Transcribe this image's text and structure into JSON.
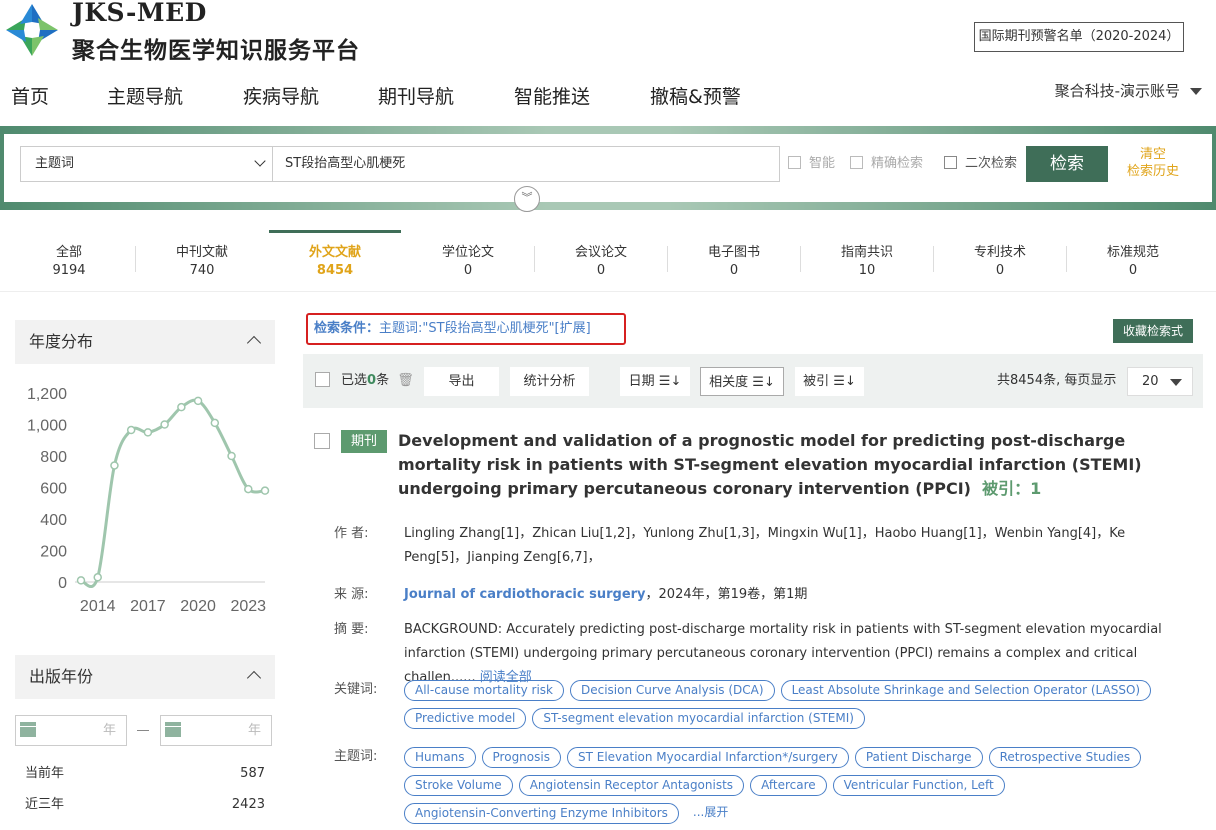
{
  "brand": {
    "en": "JKS-MED",
    "cn": "聚合生物医学知识服务平台"
  },
  "header": {
    "warning_list": "国际期刊预警名单（2020-2024）",
    "account": "聚合科技-演示账号"
  },
  "nav": [
    "首页",
    "主题导航",
    "疾病导航",
    "期刊导航",
    "智能推送",
    "撤稿&预警"
  ],
  "search": {
    "field": "主题词",
    "query": "ST段抬高型心肌梗死",
    "options": [
      "智能",
      "精确检索",
      "二次检索"
    ],
    "button": "检索",
    "clear_line1": "清空",
    "clear_line2": "检索历史"
  },
  "tabs": [
    {
      "label": "全部",
      "count": "9194"
    },
    {
      "label": "中刊文献",
      "count": "740"
    },
    {
      "label": "外文文献",
      "count": "8454"
    },
    {
      "label": "学位论文",
      "count": "0"
    },
    {
      "label": "会议论文",
      "count": "0"
    },
    {
      "label": "电子图书",
      "count": "0"
    },
    {
      "label": "指南共识",
      "count": "10"
    },
    {
      "label": "专利技术",
      "count": "0"
    },
    {
      "label": "标准规范",
      "count": "0"
    }
  ],
  "sidebar": {
    "year_dist_title": "年度分布",
    "pub_year_title": "出版年份",
    "year_unit": "年",
    "ranges": [
      {
        "label": "当前年",
        "count": "587"
      },
      {
        "label": "近三年",
        "count": "2423"
      }
    ]
  },
  "chart_data": {
    "type": "line",
    "x": [
      2013,
      2014,
      2015,
      2016,
      2017,
      2018,
      2019,
      2020,
      2021,
      2022,
      2023,
      2024
    ],
    "values": [
      10,
      30,
      740,
      965,
      950,
      1000,
      1110,
      1150,
      1010,
      800,
      590,
      580
    ],
    "x_ticks": [
      "2014",
      "2017",
      "2020",
      "2023"
    ],
    "y_ticks": [
      "0",
      "200",
      "400",
      "600",
      "800",
      "1,000",
      "1,200"
    ],
    "ylim": [
      0,
      1200
    ],
    "xlim": [
      2013,
      2024
    ],
    "color": "#9fc6ad"
  },
  "results": {
    "condition_label": "检索条件：",
    "condition_value": "主题词:\"ST段抬高型心肌梗死\"[扩展]",
    "save_query": "收藏检索式",
    "selected_prefix": "已选",
    "selected_count": "0",
    "selected_suffix": "条",
    "export": "导出",
    "stats": "统计分析",
    "sort_date": "日期 ☰↓",
    "sort_relevance": "相关度 ☰↓",
    "sort_cited": "被引 ☰↓",
    "total": "共8454条, 每页显示",
    "page_size": "20"
  },
  "article": {
    "badge": "期刊",
    "title": "Development and validation of a prognostic model for predicting post-discharge mortality risk in patients with ST-segment elevation myocardial infarction (STEMI) undergoing primary percutaneous coronary intervention (PPCI)",
    "cited": "被引：1",
    "authors_label": "作 者:",
    "authors": "Lingling Zhang[1]，Zhican Liu[1,2]，Yunlong Zhu[1,3]，Mingxin Wu[1]，Haobo Huang[1]，Wenbin Yang[4]，Ke Peng[5]，Jianping Zeng[6,7]，",
    "source_label": "来 源:",
    "journal": "Journal of cardiothoracic surgery",
    "source_rest": "，2024年，第19卷，第1期",
    "abstract_label": "摘 要:",
    "abstract": "BACKGROUND: Accurately predicting post-discharge mortality risk in patients with ST-segment elevation myocardial infarction (STEMI) undergoing primary percutaneous coronary intervention (PPCI) remains a complex and critical challen......",
    "read_all": "阅读全部",
    "keywords_label": "关键词:",
    "keywords": [
      "All-cause mortality risk",
      "Decision Curve Analysis (DCA)",
      "Least Absolute Shrinkage and Selection Operator (LASSO)",
      "Predictive model",
      "ST-segment elevation myocardial infarction (STEMI)"
    ],
    "subjects_label": "主题词:",
    "subjects": [
      "Humans",
      "Prognosis",
      "ST Elevation Myocardial Infarction*/surgery",
      "Patient Discharge",
      "Retrospective Studies",
      "Stroke Volume",
      "Angiotensin Receptor Antagonists",
      "Aftercare",
      "Ventricular Function, Left",
      "Angiotensin-Converting Enzyme Inhibitors"
    ],
    "expand": "...展开"
  }
}
